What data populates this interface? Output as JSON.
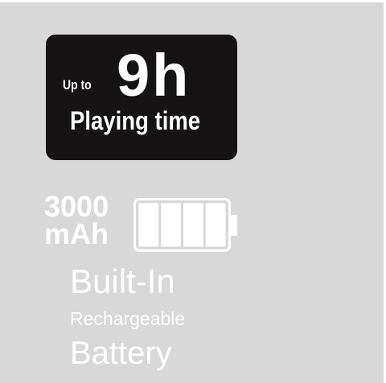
{
  "playing_time": {
    "prefix": "Up to",
    "hours": "9h",
    "caption": "Playing time"
  },
  "battery": {
    "capacity_value": "3000",
    "capacity_unit": "mAh",
    "icon": "battery-full-icon",
    "charge_level": 1.0,
    "segments": 4,
    "line1": "Built-In",
    "line2": "Rechargeable",
    "line3": "Battery"
  },
  "colors": {
    "background": "#d8d8d8",
    "badge": "#151313",
    "text": "#ffffff"
  }
}
